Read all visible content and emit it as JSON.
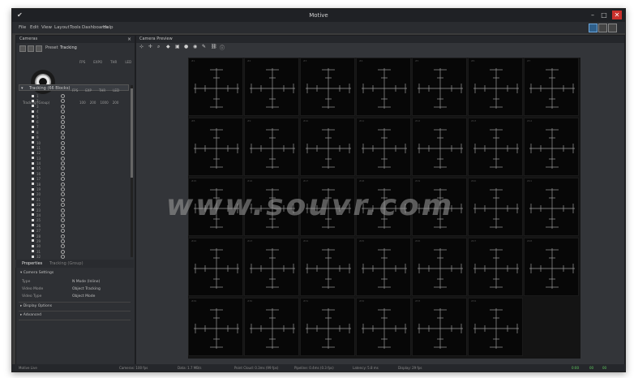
{
  "window": {
    "title": "Motive",
    "menu": [
      "File",
      "Edit",
      "View",
      "Layout",
      "Tools",
      "Dashboards",
      "Help"
    ]
  },
  "cameras_panel": {
    "title": "Cameras",
    "toolbar": {
      "preset_label": "Preset",
      "preset_value": "Tracking"
    },
    "stats_headers": [
      "FPS",
      "EXPO",
      "THR",
      "LED"
    ],
    "footer_label": "Tracking (Group)",
    "footer_values": [
      "100",
      "200",
      "1000",
      "200"
    ],
    "group_name": "Tracking (66 Blocks)",
    "list_headers": [
      "FPS",
      "EXP",
      "THR",
      "LED"
    ],
    "row_count": 34
  },
  "properties": {
    "tabs": [
      "Properties",
      "Tracking (Group)"
    ],
    "sections": [
      {
        "title": "Camera Settings",
        "rows": [
          {
            "label": "Type",
            "value": "N Mode (Inline)"
          },
          {
            "label": "Video Mode",
            "value": "Object Tracking"
          },
          {
            "label": "Video Type",
            "value": "Object Mode"
          }
        ]
      },
      {
        "title": "Display Options",
        "rows": []
      },
      {
        "title": "Advanced",
        "rows": []
      }
    ]
  },
  "preview": {
    "title": "Camera Preview",
    "toolbar_icons": [
      "select-icon",
      "crosshair-icon",
      "zoom-icon",
      "marker-icon",
      "camera-icon",
      "record-icon",
      "eye-icon",
      "pencil-icon",
      "link-icon",
      "info-icon"
    ],
    "grid_rows": 5,
    "grid_cols": 7,
    "last_row_cols": 6
  },
  "watermark": "www.souvr.com",
  "status": {
    "left": "Motive Live",
    "cameras": "Cameras: 100 fps",
    "data": "Data: 1.7 MB/s",
    "frame": "Point Cloud: 0.3ms (99 fps)",
    "pipeline": "Pipeline: 0.4ms (0.3 fps)",
    "latency": "Latency: 5.8 ms",
    "display": "Display: 29 fps",
    "ok_labels": [
      "0:00",
      "00",
      "00"
    ]
  }
}
